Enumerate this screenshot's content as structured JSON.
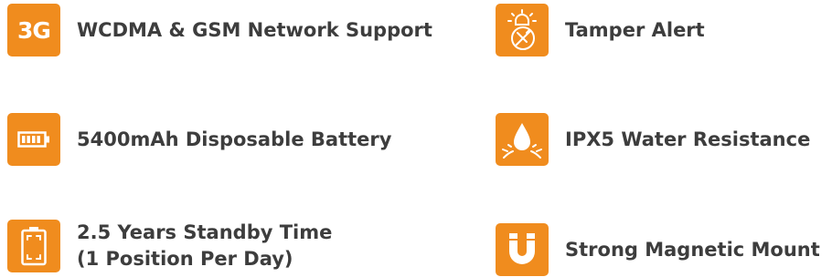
{
  "colors": {
    "accent": "#f08c1e",
    "text": "#3d3d3d",
    "icon_fg": "#ffffff"
  },
  "features": [
    {
      "icon": "3g-badge-icon",
      "icon_text": "3G",
      "label": "WCDMA & GSM Network Support"
    },
    {
      "icon": "tamper-alert-icon",
      "label": "Tamper Alert"
    },
    {
      "icon": "battery-icon",
      "label": "5400mAh Disposable Battery"
    },
    {
      "icon": "water-drop-icon",
      "label": "IPX5 Water Resistance"
    },
    {
      "icon": "standby-battery-icon",
      "label_line1": "2.5 Years Standby Time",
      "label_line2": "(1 Position Per Day)"
    },
    {
      "icon": "magnet-icon",
      "label": "Strong Magnetic Mount"
    }
  ]
}
